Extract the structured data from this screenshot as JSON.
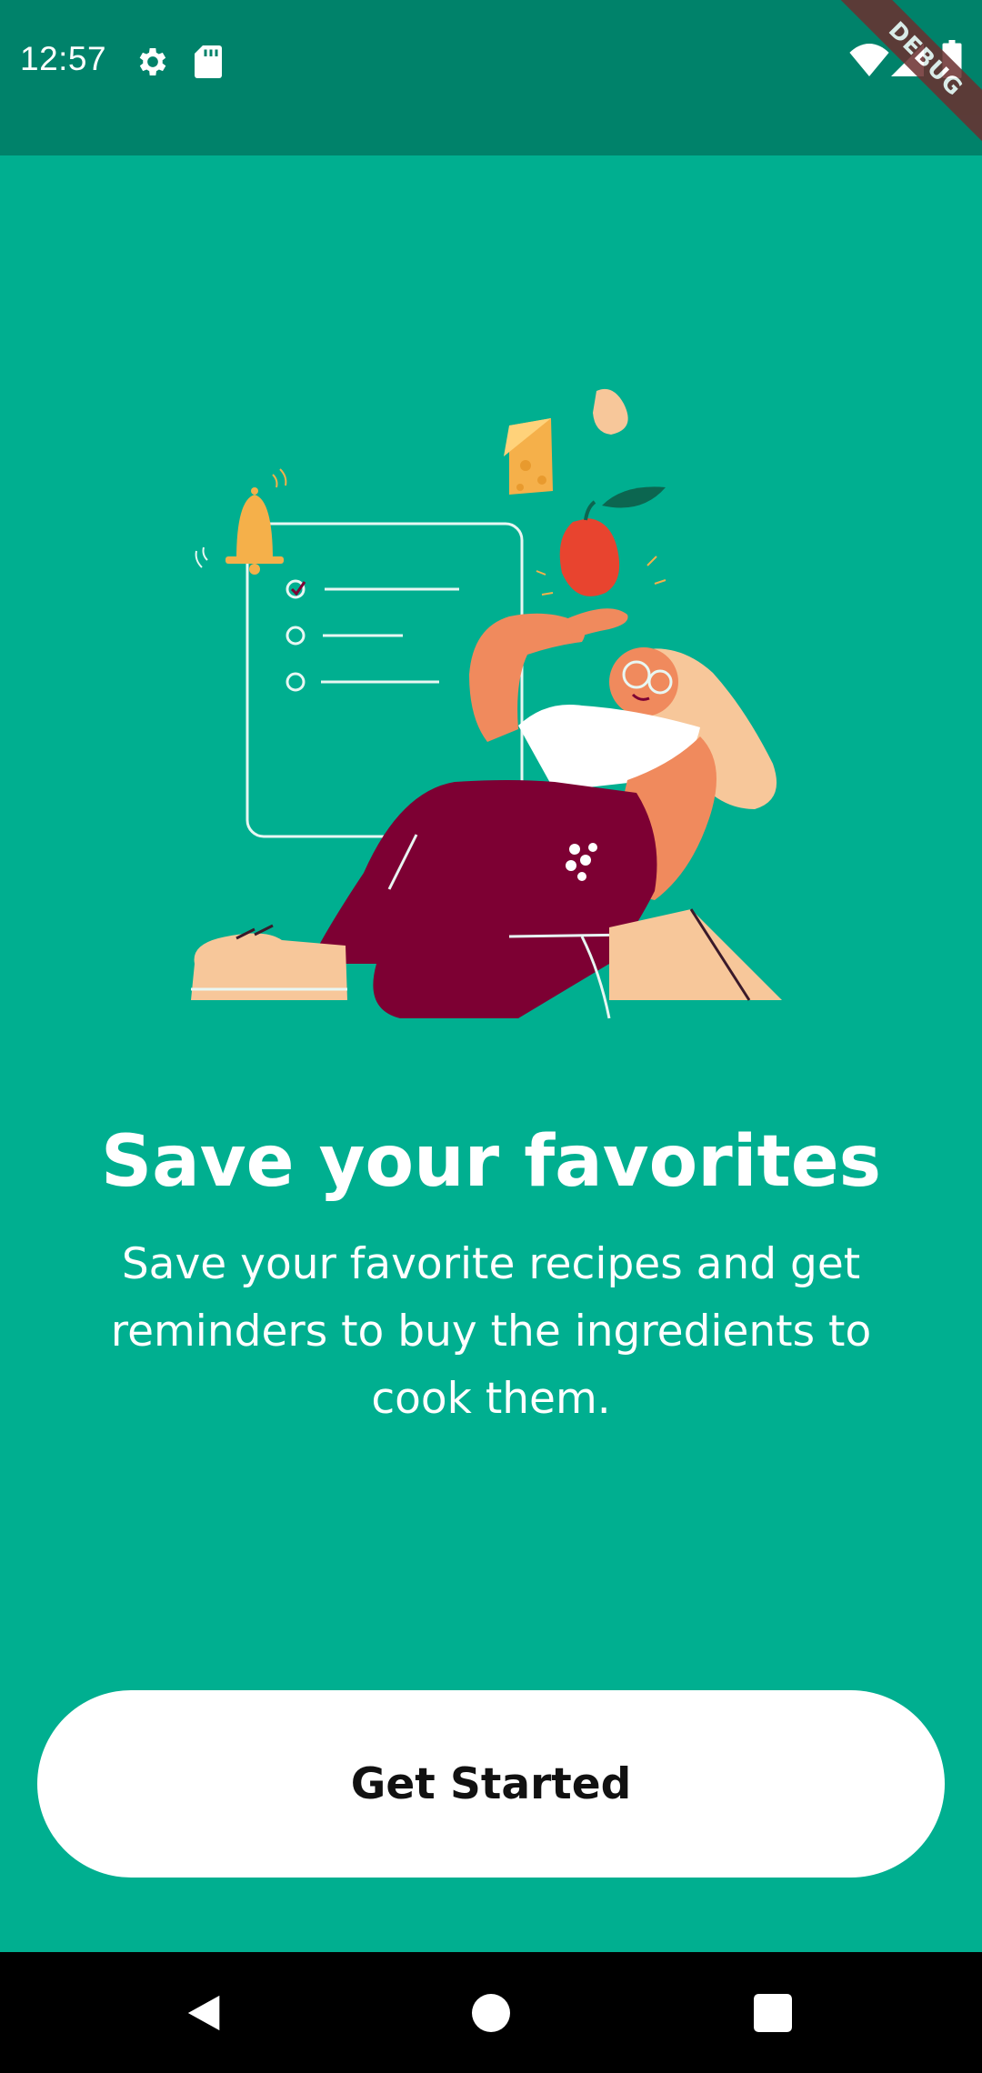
{
  "status_bar": {
    "time": "12:57",
    "icons": [
      "gear-icon",
      "sd-card-icon",
      "wifi-icon",
      "signal-icon",
      "battery-icon"
    ],
    "debug_label": "DEBUG"
  },
  "onboarding": {
    "title": "Save your favorites",
    "description": "Save your favorite recipes and get reminders to buy the ingredients to cook them.",
    "button_label": "Get Started"
  },
  "nav_bar": {
    "items": [
      "back-icon",
      "home-icon",
      "recents-icon"
    ]
  },
  "colors": {
    "background": "#00af90",
    "status_bar": "#00826a",
    "button": "#ffffff",
    "button_text": "#111111",
    "pants": "#7d0033",
    "skin": "#f08a5d",
    "bell": "#f5b04a"
  }
}
